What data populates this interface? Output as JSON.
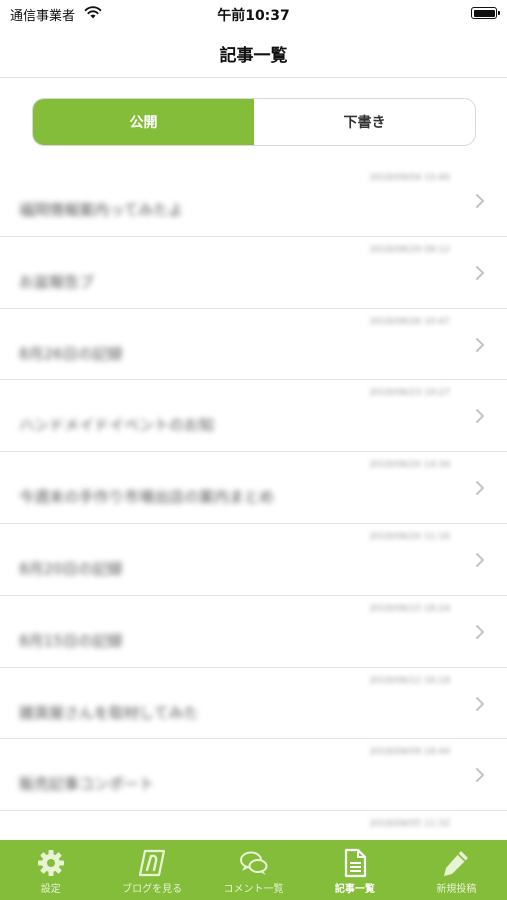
{
  "status_bar": {
    "carrier": "通信事業者",
    "time": "午前10:37"
  },
  "nav": {
    "title": "記事一覧"
  },
  "segments": [
    {
      "label": "公開",
      "active": true
    },
    {
      "label": "下書き",
      "active": false
    }
  ],
  "articles": [
    {
      "date": "2018/09/04 15:40",
      "title": "福岡情報案内ってみたよ"
    },
    {
      "date": "2018/08/29 09:12",
      "title": "お盆報告ブ"
    },
    {
      "date": "2018/08/26 10:47",
      "title": "8月26日の記録"
    },
    {
      "date": "2018/08/23 19:27",
      "title": "ハンドメイドイベントのお知"
    },
    {
      "date": "2018/08/20 14:34",
      "title": "今週末の手作り市場出店の案内まとめ"
    },
    {
      "date": "2018/08/20 11:16",
      "title": "8月20日の記録"
    },
    {
      "date": "2018/08/15 18:24",
      "title": "8月15日の記録"
    },
    {
      "date": "2018/08/12 16:18",
      "title": "雑貨屋さんを取材してみた"
    },
    {
      "date": "2018/08/09 18:44",
      "title": "販売記事コンポート"
    },
    {
      "date": "2018/08/05 11:32",
      "title": ""
    }
  ],
  "tabs": [
    {
      "name": "settings",
      "label": "設定",
      "icon": "gear-icon",
      "active": false
    },
    {
      "name": "view-blog",
      "label": "ブログを見る",
      "icon": "blog-logo-icon",
      "active": false
    },
    {
      "name": "comments",
      "label": "コメント一覧",
      "icon": "speech-bubbles-icon",
      "active": false
    },
    {
      "name": "articles",
      "label": "記事一覧",
      "icon": "document-icon",
      "active": true
    },
    {
      "name": "new-post",
      "label": "新規投稿",
      "icon": "pencil-icon",
      "active": false
    }
  ],
  "colors": {
    "accent": "#84bd3a",
    "tab_label_inactive": "#e8f3d6"
  }
}
